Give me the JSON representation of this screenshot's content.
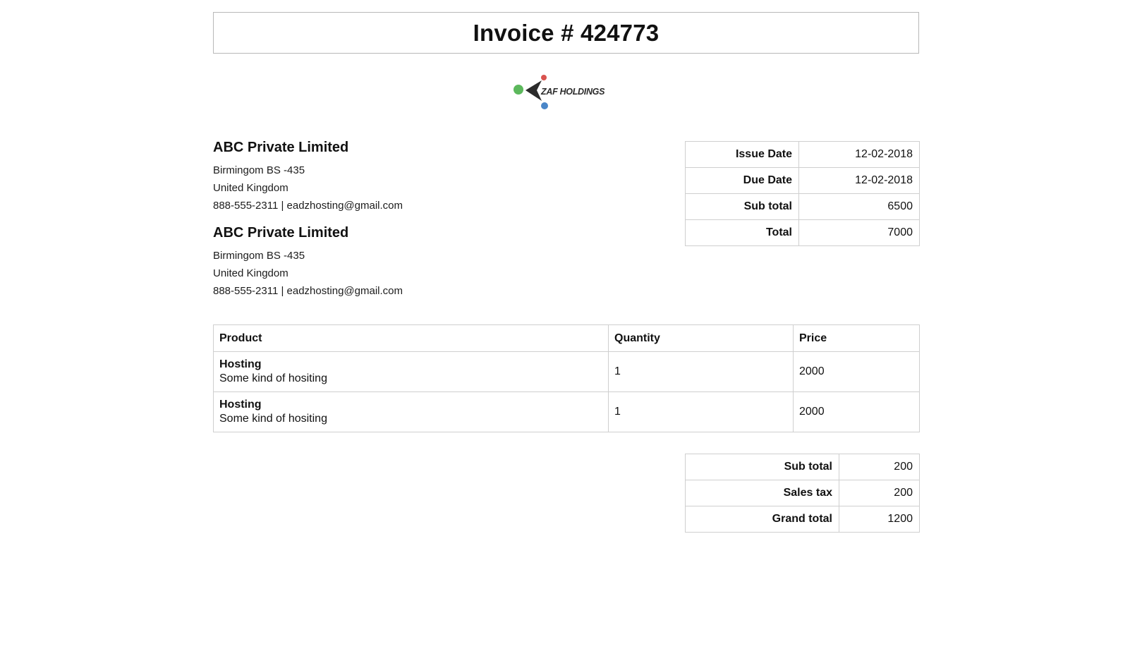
{
  "invoice": {
    "title": "Invoice # 424773"
  },
  "logo": {
    "text": "ZAF HOLDINGS",
    "colors": {
      "green": "#5cb85c",
      "red": "#d9534f",
      "blue": "#4a86c8",
      "mark": "#2b2b2b"
    }
  },
  "parties": [
    {
      "name": "ABC Private Limited",
      "address1": "Birmingom BS -435",
      "address2": "United Kingdom",
      "contact": "888-555-2311 | eadzhosting@gmail.com"
    },
    {
      "name": "ABC Private Limited",
      "address1": "Birmingom BS -435",
      "address2": "United Kingdom",
      "contact": "888-555-2311 | eadzhosting@gmail.com"
    }
  ],
  "meta": {
    "rows": [
      {
        "label": "Issue Date",
        "value": "12-02-2018"
      },
      {
        "label": "Due Date",
        "value": "12-02-2018"
      },
      {
        "label": "Sub total",
        "value": "6500"
      },
      {
        "label": "Total",
        "value": "7000"
      }
    ]
  },
  "items": {
    "headers": {
      "product": "Product",
      "quantity": "Quantity",
      "price": "Price"
    },
    "rows": [
      {
        "name": "Hosting",
        "description": "Some kind of hositing",
        "quantity": "1",
        "price": "2000"
      },
      {
        "name": "Hosting",
        "description": "Some kind of hositing",
        "quantity": "1",
        "price": "2000"
      }
    ]
  },
  "totals": {
    "rows": [
      {
        "label": "Sub total",
        "value": "200"
      },
      {
        "label": "Sales tax",
        "value": "200"
      },
      {
        "label": "Grand total",
        "value": "1200"
      }
    ]
  }
}
